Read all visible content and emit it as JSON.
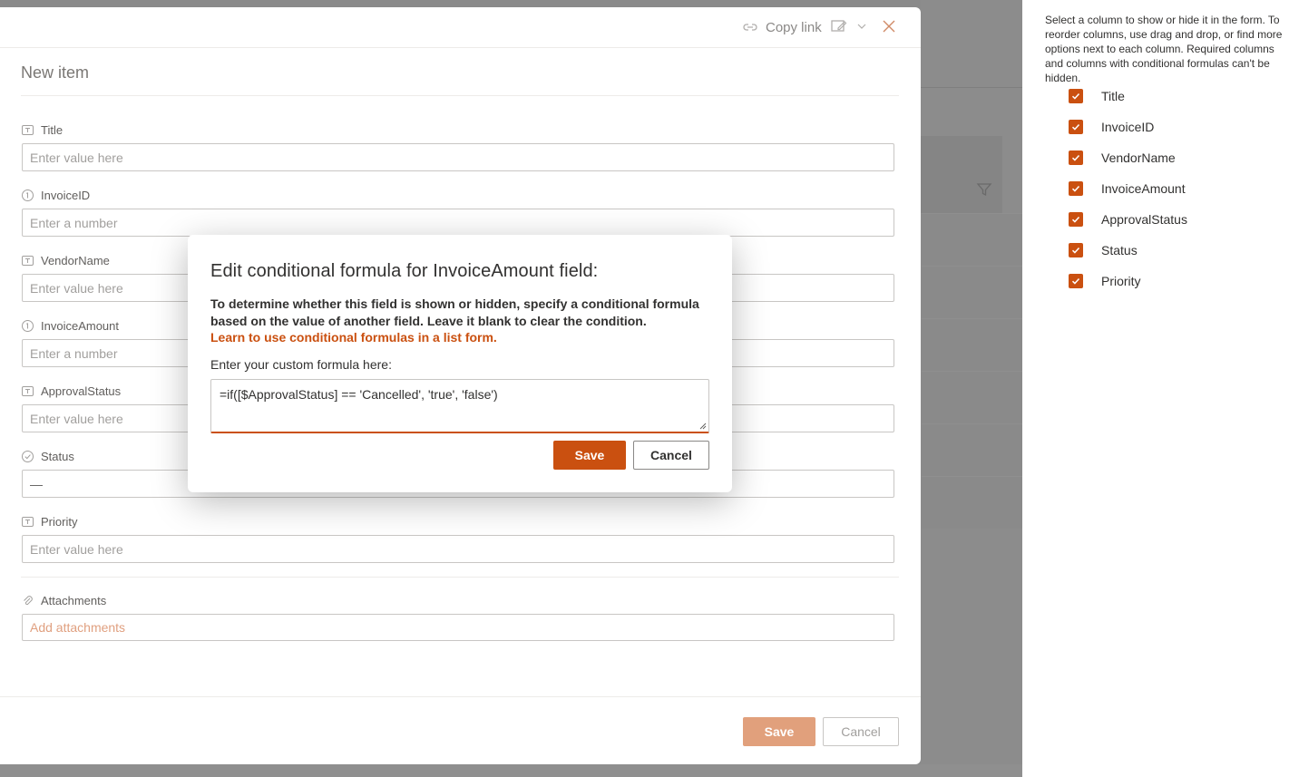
{
  "panel": {
    "copy_link": "Copy link",
    "title": "New item",
    "fields": [
      {
        "label": "Title",
        "placeholder": "Enter value here"
      },
      {
        "label": "InvoiceID",
        "placeholder": "Enter a number"
      },
      {
        "label": "VendorName",
        "placeholder": "Enter value here"
      },
      {
        "label": "InvoiceAmount",
        "placeholder": "Enter a number"
      },
      {
        "label": "ApprovalStatus",
        "placeholder": "Enter value here"
      },
      {
        "label": "Status",
        "placeholder": "—"
      },
      {
        "label": "Priority",
        "placeholder": "Enter value here"
      }
    ],
    "attachments": {
      "label": "Attachments",
      "action": "Add attachments"
    },
    "save_label": "Save",
    "cancel_label": "Cancel"
  },
  "dialog": {
    "title": "Edit conditional formula for InvoiceAmount field:",
    "description": "To determine whether this field is shown or hidden, specify a conditional formula based on the value of another field. Leave it blank to clear the condition.",
    "learn_link": "Learn to use conditional formulas in a list form.",
    "formula_label": "Enter your custom formula here:",
    "formula_value": "=if([$ApprovalStatus] == 'Cancelled', 'true', 'false')",
    "save_label": "Save",
    "cancel_label": "Cancel"
  },
  "right_panel": {
    "help_text": "Select a column to show or hide it in the form. To reorder columns, use drag and drop, or find more options next to each column. Required columns and columns with conditional formulas can't be hidden.",
    "columns": [
      {
        "label": "Title",
        "checked": true
      },
      {
        "label": "InvoiceID",
        "checked": true
      },
      {
        "label": "VendorName",
        "checked": true
      },
      {
        "label": "InvoiceAmount",
        "checked": true
      },
      {
        "label": "ApprovalStatus",
        "checked": true
      },
      {
        "label": "Status",
        "checked": true
      },
      {
        "label": "Priority",
        "checked": true
      }
    ]
  },
  "colors": {
    "accent": "#ca5010",
    "accent_disabled": "#e1a07c",
    "overlay": "#8a8a8a"
  }
}
